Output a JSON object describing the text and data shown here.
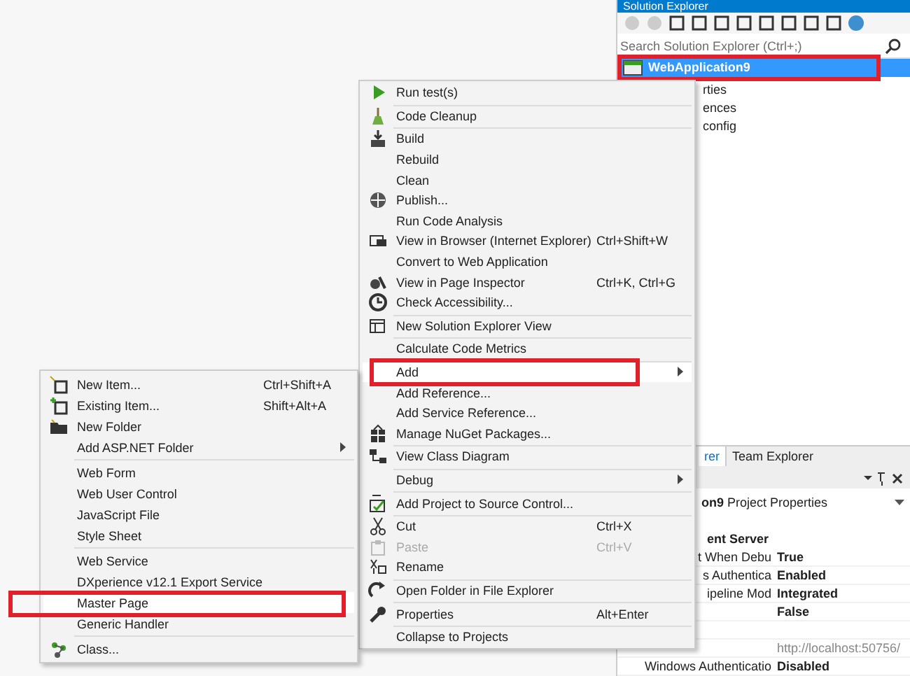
{
  "solution_explorer": {
    "title": "Solution Explorer",
    "search": {
      "placeholder": "Search Solution Explorer (Ctrl+;)"
    },
    "tree": [
      {
        "label": "WebApplication9",
        "selected": true,
        "children": [
          {
            "label": "rties",
            "selected": false
          },
          {
            "label": "ences",
            "selected": false
          },
          {
            "label": "config",
            "selected": false
          }
        ]
      }
    ],
    "tabs": [
      {
        "label": "rer",
        "selected": true
      },
      {
        "label": "Team Explorer",
        "selected": false
      }
    ]
  },
  "properties": {
    "object": "**on9** Project Properties",
    "rows": [
      {
        "kind": "category",
        "label": "ent Server"
      },
      {
        "kind": "property",
        "label": "t When Debu",
        "value": "True"
      },
      {
        "kind": "property",
        "label": "s Authentica",
        "value": "Enabled"
      },
      {
        "kind": "property",
        "label": "ipeline Mod",
        "value": "Integrated"
      },
      {
        "kind": "property",
        "label": "",
        "value": "False"
      },
      {
        "kind": "blank"
      },
      {
        "kind": "url",
        "value": "http://localhost:50756/"
      },
      {
        "kind": "property",
        "label": "Windows Authenticatio",
        "value": "Disabled"
      }
    ]
  },
  "context_menu": {
    "items": [
      {
        "kind": "item",
        "label": "Run test(s)",
        "selected": false,
        "disabled": false
      },
      {
        "kind": "separator"
      },
      {
        "kind": "item",
        "label": "Code Cleanup",
        "selected": false,
        "disabled": false
      },
      {
        "kind": "separator"
      },
      {
        "kind": "item",
        "label": "Build",
        "selected": false,
        "disabled": false
      },
      {
        "kind": "item",
        "label": "Rebuild",
        "selected": false,
        "disabled": false
      },
      {
        "kind": "item",
        "label": "Clean",
        "selected": false,
        "disabled": false
      },
      {
        "kind": "item",
        "label": "Publish...",
        "selected": false,
        "disabled": false
      },
      {
        "kind": "item",
        "label": "Run Code Analysis",
        "selected": false,
        "disabled": false
      },
      {
        "kind": "item",
        "label": "View in Browser (Internet Explorer)",
        "shortcut": "Ctrl+Shift+W",
        "selected": false,
        "disabled": false
      },
      {
        "kind": "item",
        "label": "Convert to Web Application",
        "selected": false,
        "disabled": false
      },
      {
        "kind": "item",
        "label": "View in Page Inspector",
        "shortcut": "Ctrl+K, Ctrl+G",
        "selected": false,
        "disabled": false
      },
      {
        "kind": "item",
        "label": "Check Accessibility...",
        "selected": false,
        "disabled": false
      },
      {
        "kind": "separator"
      },
      {
        "kind": "item",
        "label": "New Solution Explorer View",
        "selected": false,
        "disabled": false
      },
      {
        "kind": "separator"
      },
      {
        "kind": "item",
        "label": "Calculate Code Metrics",
        "selected": false,
        "disabled": false
      },
      {
        "kind": "separator"
      },
      {
        "kind": "item",
        "label": "Add",
        "submenu": true,
        "selected": true,
        "disabled": false
      },
      {
        "kind": "item",
        "label": "Add Reference...",
        "selected": false,
        "disabled": false
      },
      {
        "kind": "item",
        "label": "Add Service Reference...",
        "selected": false,
        "disabled": false
      },
      {
        "kind": "item",
        "label": "Manage NuGet Packages...",
        "selected": false,
        "disabled": false
      },
      {
        "kind": "separator"
      },
      {
        "kind": "item",
        "label": "View Class Diagram",
        "selected": false,
        "disabled": false
      },
      {
        "kind": "separator"
      },
      {
        "kind": "item",
        "label": "Debug",
        "submenu": true,
        "selected": false,
        "disabled": false
      },
      {
        "kind": "separator"
      },
      {
        "kind": "item",
        "label": "Add Project to Source Control...",
        "selected": false,
        "disabled": false
      },
      {
        "kind": "separator"
      },
      {
        "kind": "item",
        "label": "Cut",
        "shortcut": "Ctrl+X",
        "selected": false,
        "disabled": false
      },
      {
        "kind": "item",
        "label": "Paste",
        "shortcut": "Ctrl+V",
        "selected": false,
        "disabled": true
      },
      {
        "kind": "item",
        "label": "Rename",
        "selected": false,
        "disabled": false
      },
      {
        "kind": "separator"
      },
      {
        "kind": "item",
        "label": "Open Folder in File Explorer",
        "selected": false,
        "disabled": false
      },
      {
        "kind": "separator"
      },
      {
        "kind": "item",
        "label": "Properties",
        "shortcut": "Alt+Enter",
        "selected": false,
        "disabled": false
      },
      {
        "kind": "separator"
      },
      {
        "kind": "item",
        "label": "Collapse to Projects",
        "selected": false,
        "disabled": false
      }
    ]
  },
  "add_submenu": {
    "items": [
      {
        "kind": "item",
        "label": "New Item...",
        "shortcut": "Ctrl+Shift+A",
        "selected": false
      },
      {
        "kind": "item",
        "label": "Existing Item...",
        "shortcut": "Shift+Alt+A",
        "selected": false
      },
      {
        "kind": "item",
        "label": "New Folder",
        "selected": false
      },
      {
        "kind": "item",
        "label": "Add ASP.NET Folder",
        "submenu": true,
        "selected": false
      },
      {
        "kind": "separator"
      },
      {
        "kind": "item",
        "label": "Web Form",
        "selected": false
      },
      {
        "kind": "item",
        "label": "Web User Control",
        "selected": false
      },
      {
        "kind": "item",
        "label": "JavaScript File",
        "selected": false
      },
      {
        "kind": "item",
        "label": "Style Sheet",
        "selected": false
      },
      {
        "kind": "separator"
      },
      {
        "kind": "item",
        "label": "Web Service",
        "selected": false
      },
      {
        "kind": "item",
        "label": "DXperience v12.1 Export Service",
        "selected": false
      },
      {
        "kind": "item",
        "label": "Master Page",
        "selected": true
      },
      {
        "kind": "item",
        "label": "Generic Handler",
        "selected": false
      },
      {
        "kind": "separator"
      },
      {
        "kind": "item",
        "label": "Class...",
        "selected": false
      }
    ]
  }
}
